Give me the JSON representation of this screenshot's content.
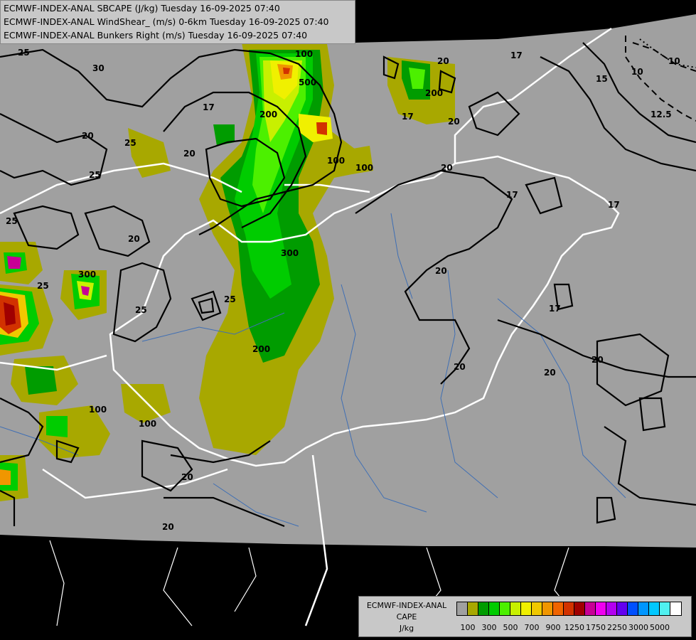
{
  "title_lines": [
    "ECMWF-INDEX-ANAL SBCAPE (J/kg) Tuesday 16-09-2025 07:40",
    "ECMWF-INDEX-ANAL WindShear_ (m/s) 0-6km Tuesday 16-09-2025 07:40",
    "ECMWF-INDEX-ANAL Bunkers Right (m/s) Tuesday 16-09-2025 07:40"
  ],
  "legend": {
    "title_line1": "ECMWF-INDEX-ANAL",
    "title_line2": "CAPE",
    "title_line3": "J/kg",
    "colors": [
      "#a0a0a0",
      "#a8a800",
      "#009c00",
      "#00cc00",
      "#4cf000",
      "#c8f000",
      "#f0f000",
      "#f0c800",
      "#f09600",
      "#f06400",
      "#d23200",
      "#a00000",
      "#c80096",
      "#f000f0",
      "#b400f0",
      "#6400f0",
      "#0050ff",
      "#0096ff",
      "#00c8ff",
      "#50f0f0",
      "#ffffff"
    ],
    "tick_labels": [
      "100",
      "300",
      "500",
      "700",
      "900",
      "1250",
      "1750",
      "2250",
      "3000",
      "5000"
    ]
  },
  "contour_labels": [
    "25",
    "30",
    "20",
    "17",
    "25",
    "20",
    "25",
    "25",
    "17",
    "20",
    "20",
    "20",
    "17",
    "17",
    "20",
    "17",
    "20",
    "20",
    "20",
    "20",
    "25",
    "25",
    "20",
    "12.5",
    "15",
    "10",
    "10",
    "100",
    "100",
    "300",
    "500",
    "200",
    "200",
    "100",
    "100",
    "200",
    "300",
    "25",
    "20",
    "17",
    "100"
  ]
}
